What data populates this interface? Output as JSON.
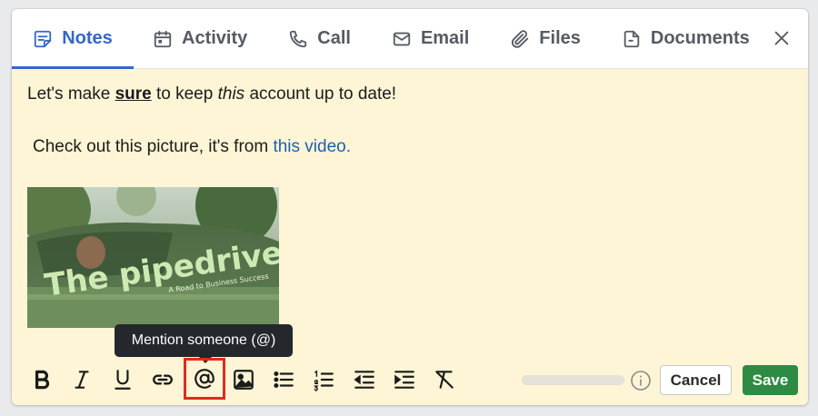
{
  "tabs": {
    "notes": "Notes",
    "activity": "Activity",
    "call": "Call",
    "email": "Email",
    "files": "Files",
    "documents": "Documents"
  },
  "editor": {
    "line1_before": "Let's make ",
    "line1_bold": "sure",
    "line1_mid": " to keep ",
    "line1_italic": "this",
    "line1_after": " account up to date!",
    "line2_text": "Check out this picture, it's from ",
    "line2_link": "this video.",
    "picture_title": "The pipedrive",
    "picture_subtitle": "A Road to Business Success"
  },
  "tooltip": "Mention someone (@)",
  "toolbar": {
    "icons": [
      "bold-icon",
      "italic-icon",
      "underline-icon",
      "link-icon",
      "mention-icon",
      "image-icon",
      "bulleted-list-icon",
      "numbered-list-icon",
      "outdent-icon",
      "indent-icon",
      "clear-formatting-icon"
    ],
    "cancel_label": "Cancel",
    "save_label": "Save"
  },
  "colors": {
    "accent": "#3566c8",
    "editor_background": "#fdf5d5",
    "save": "#2f8a43",
    "link": "#1e5fb0",
    "highlight": "#e02b20"
  }
}
